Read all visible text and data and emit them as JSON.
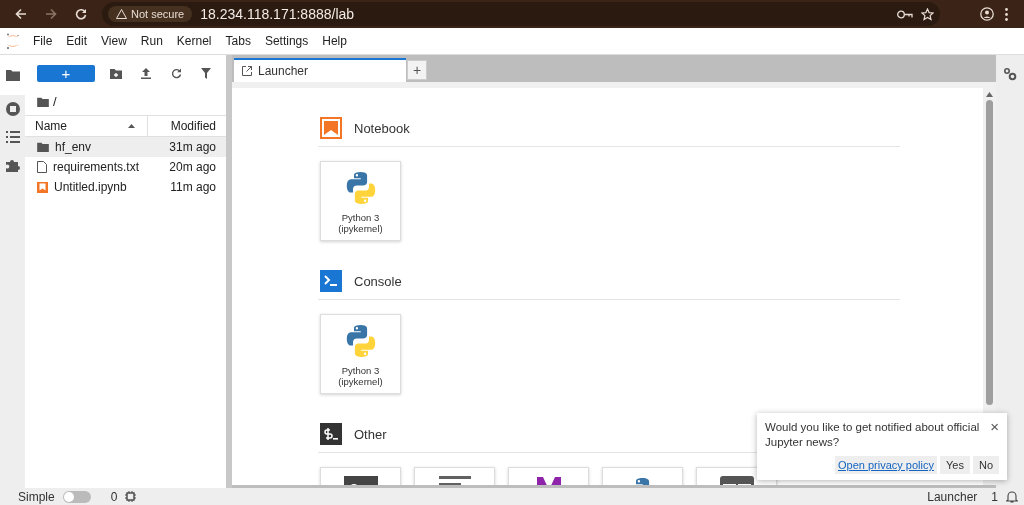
{
  "browser": {
    "security": "Not secure",
    "url": "18.234.118.171:8888/lab"
  },
  "menu": [
    "File",
    "Edit",
    "View",
    "Run",
    "Kernel",
    "Tabs",
    "Settings",
    "Help"
  ],
  "sidebar": {
    "items": [
      {
        "kind": "folder",
        "selected": true
      },
      {
        "kind": "running",
        "selected": false
      },
      {
        "kind": "toc",
        "selected": false
      },
      {
        "kind": "extensions",
        "selected": false
      }
    ]
  },
  "file_browser": {
    "new_label": "+",
    "path": "/",
    "columns": [
      "Name",
      "Modified"
    ],
    "rows": [
      {
        "name": "hf_env",
        "modified": "31m ago",
        "kind": "folder",
        "selected": true
      },
      {
        "name": "requirements.txt",
        "modified": "20m ago",
        "kind": "file",
        "selected": false
      },
      {
        "name": "Untitled.ipynb",
        "modified": "11m ago",
        "kind": "notebook",
        "selected": false
      }
    ]
  },
  "tabs": [
    {
      "label": "Launcher",
      "selected": true
    }
  ],
  "new_tab": "+",
  "launcher": {
    "sections": [
      {
        "title": "Notebook",
        "kind": "notebook",
        "cards": [
          {
            "label": "Python 3 (ipykernel)",
            "kind": "python"
          }
        ]
      },
      {
        "title": "Console",
        "kind": "console",
        "cards": [
          {
            "label": "Python 3 (ipykernel)",
            "kind": "python"
          }
        ]
      },
      {
        "title": "Other",
        "kind": "other",
        "cards": [
          {
            "kind": "terminal"
          },
          {
            "kind": "text"
          },
          {
            "kind": "markdown"
          },
          {
            "kind": "python"
          },
          {
            "kind": "help"
          }
        ]
      }
    ]
  },
  "notification": {
    "message": "Would you like to get notified about official Jupyter news?",
    "close": "×",
    "link": "Open privacy policy",
    "buttons": [
      "Yes",
      "No"
    ]
  },
  "status_bar": {
    "mode": "Simple",
    "simple_on": false,
    "kernels": "0",
    "current": "Launcher",
    "notifications": "1"
  }
}
